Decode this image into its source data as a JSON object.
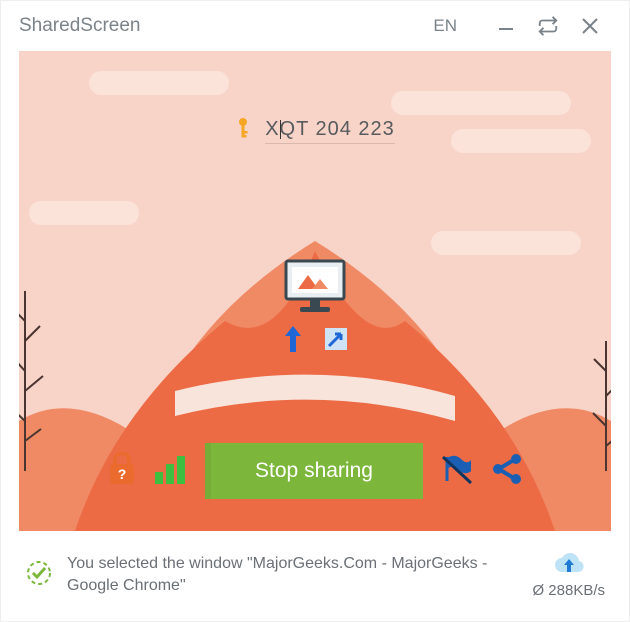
{
  "titlebar": {
    "title": "SharedScreen",
    "language": "EN"
  },
  "session": {
    "code": "XQT 204 223"
  },
  "controls": {
    "stop_label": "Stop sharing"
  },
  "status": {
    "message": "You selected the window \"MajorGeeks.Com - MajorGeeks - Google Chrome\"",
    "speed": "Ø 288KB/s"
  }
}
